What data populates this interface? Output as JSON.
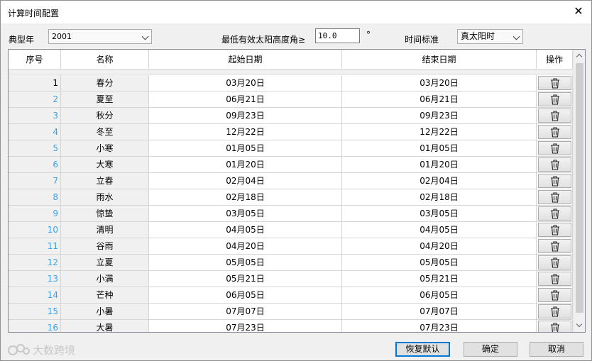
{
  "window": {
    "title": "计算时间配置",
    "close_glyph": "✕"
  },
  "controls": {
    "year_label": "典型年",
    "year_value": "2001",
    "min_alt_label": "最低有效太阳高度角≥",
    "min_alt_value": "10.0",
    "degree_symbol": "°",
    "time_std_label": "时间标准",
    "time_std_value": "真太阳时"
  },
  "table": {
    "headers": [
      "序号",
      "名称",
      "起始日期",
      "结束日期",
      "操作"
    ],
    "rows": [
      {
        "idx": "1",
        "name": "春分",
        "start": "03月20日",
        "end": "03月20日"
      },
      {
        "idx": "2",
        "name": "夏至",
        "start": "06月21日",
        "end": "06月21日"
      },
      {
        "idx": "3",
        "name": "秋分",
        "start": "09月23日",
        "end": "09月23日"
      },
      {
        "idx": "4",
        "name": "冬至",
        "start": "12月22日",
        "end": "12月22日"
      },
      {
        "idx": "5",
        "name": "小寒",
        "start": "01月05日",
        "end": "01月05日"
      },
      {
        "idx": "6",
        "name": "大寒",
        "start": "01月20日",
        "end": "01月20日"
      },
      {
        "idx": "7",
        "name": "立春",
        "start": "02月04日",
        "end": "02月04日"
      },
      {
        "idx": "8",
        "name": "雨水",
        "start": "02月18日",
        "end": "02月18日"
      },
      {
        "idx": "9",
        "name": "惊蛰",
        "start": "03月05日",
        "end": "03月05日"
      },
      {
        "idx": "10",
        "name": "清明",
        "start": "04月05日",
        "end": "04月05日"
      },
      {
        "idx": "11",
        "name": "谷雨",
        "start": "04月20日",
        "end": "04月20日"
      },
      {
        "idx": "12",
        "name": "立夏",
        "start": "05月05日",
        "end": "05月05日"
      },
      {
        "idx": "13",
        "name": "小满",
        "start": "05月21日",
        "end": "05月21日"
      },
      {
        "idx": "14",
        "name": "芒种",
        "start": "06月05日",
        "end": "06月05日"
      },
      {
        "idx": "15",
        "name": "小暑",
        "start": "07月07日",
        "end": "07月07日"
      },
      {
        "idx": "16",
        "name": "大暑",
        "start": "07月23日",
        "end": "07月23日"
      }
    ],
    "row_action_icon": "trash-icon"
  },
  "footer": {
    "watermark": "大数跨境",
    "restore_label": "恢复默认",
    "ok_label": "确定",
    "cancel_label": "取消"
  },
  "colors": {
    "index_link": "#3da0e6",
    "default_button_border": "#0078d7"
  }
}
